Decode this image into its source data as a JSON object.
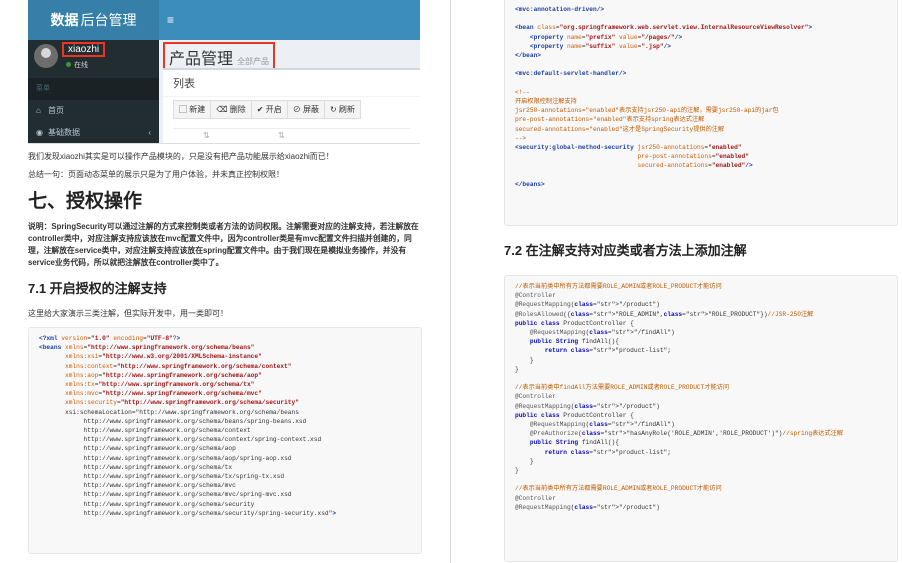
{
  "left_page": {
    "screenshot": {
      "logo_bold": "数据",
      "logo_rest": "后台管理",
      "menu_toggle": "≡",
      "username": "xiaozhi",
      "online": "在线",
      "menu_header": "菜单",
      "menu_items": [
        {
          "icon": "home-icon",
          "label": "首页"
        },
        {
          "icon": "folder-icon",
          "label": "基础数据",
          "arrow": "‹"
        }
      ],
      "page_title": "产品管理",
      "page_subtitle": "全部产品",
      "box_title": "列表",
      "buttons": [
        "新建",
        "删除",
        "开启",
        "屏蔽",
        "刷新"
      ],
      "table_header": [
        "⇅",
        "⇅"
      ]
    },
    "para1": "我们发现xiaozhi其实是可以操作产品模块的，只是没有把产品功能展示给xiaozhi而已！",
    "para2": "总结一句：页面动态菜单的展示只是为了用户体验，并未真正控制权限！",
    "heading": "七、授权操作",
    "note": "说明：SpringSecurity可以通过注解的方式来控制类或者方法的访问权限。注解需要对应的注解支持，若注解放在controller类中，对应注解支持应该放在mvc配置文件中，因为controller类是有mvc配置文件扫描并创建的，同理，注解放在service类中，对应注解支持应该放在spring配置文件中。由于我们现在是模拟业务操作，并没有service业务代码，所以就把注解放在controller类中了。",
    "sub_heading": "7.1 开启授权的注解支持",
    "para3": "这里给大家演示三类注解，但实际开发中，用一类即可！",
    "code_lines": [
      "<?xml version=\"1.0\" encoding=\"UTF-8\"?>",
      "<beans xmlns=\"http://www.springframework.org/schema/beans\"",
      "       xmlns:xsi=\"http://www.w3.org/2001/XMLSchema-instance\"",
      "       xmlns:context=\"http://www.springframework.org/schema/context\"",
      "       xmlns:aop=\"http://www.springframework.org/schema/aop\"",
      "       xmlns:tx=\"http://www.springframework.org/schema/tx\"",
      "       xmlns:mvc=\"http://www.springframework.org/schema/mvc\"",
      "       xmlns:security=\"http://www.springframework.org/schema/security\"",
      "       xsi:schemaLocation=\"http://www.springframework.org/schema/beans",
      "            http://www.springframework.org/schema/beans/spring-beans.xsd",
      "            http://www.springframework.org/schema/context",
      "            http://www.springframework.org/schema/context/spring-context.xsd",
      "            http://www.springframework.org/schema/aop",
      "            http://www.springframework.org/schema/aop/spring-aop.xsd",
      "            http://www.springframework.org/schema/tx",
      "            http://www.springframework.org/schema/tx/spring-tx.xsd",
      "            http://www.springframework.org/schema/mvc",
      "            http://www.springframework.org/schema/mvc/spring-mvc.xsd",
      "            http://www.springframework.org/schema/security",
      "            http://www.springframework.org/schema/security/spring-security.xsd\">"
    ]
  },
  "right_page": {
    "code1_lines": [
      "<mvc:annotation-driven/>",
      "",
      "<bean class=\"org.springframework.web.servlet.view.InternalResourceViewResolver\">",
      "    <property name=\"prefix\" value=\"/pages/\"/>",
      "    <property name=\"suffix\" value=\".jsp\"/>",
      "</bean>",
      "",
      "<mvc:default-servlet-handler/>",
      "",
      "<!--",
      "开启权限控制注解支持",
      "jsr250-annotations=\"enabled\"表示支持jsr250-api的注解，需要jsr250-api的jar包",
      "pre-post-annotations=\"enabled\"表示支持spring表达式注解",
      "secured-annotations=\"enabled\"这才是SpringSecurity提供的注解",
      "-->",
      "<security:global-method-security jsr250-annotations=\"enabled\"",
      "                                 pre-post-annotations=\"enabled\"",
      "                                 secured-annotations=\"enabled\"/>",
      "",
      "</beans>"
    ],
    "heading": "7.2 在注解支持对应类或者方法上添加注解",
    "code2_lines": [
      "//表示当前类中所有方法都需要ROLE_ADMIN或者ROLE_PRODUCT才能访问",
      "@Controller",
      "@RequestMapping(\"/product\")",
      "@RolesAllowed({\"ROLE_ADMIN\",\"ROLE_PRODUCT\"})//JSR-250注解",
      "public class ProductController {",
      "    @RequestMapping(\"/findAll\")",
      "    public String findAll(){",
      "        return \"product-list\";",
      "    }",
      "}",
      "",
      "//表示当前类中findAll方法需要ROLE_ADMIN或者ROLE_PRODUCT才能访问",
      "@Controller",
      "@RequestMapping(\"/product\")",
      "public class ProductController {",
      "    @RequestMapping(\"/findAll\")",
      "    @PreAuthorize(\"hasAnyRole('ROLE_ADMIN','ROLE_PRODUCT')\")//spring表达式注解",
      "    public String findAll(){",
      "        return \"product-list\";",
      "    }",
      "}",
      "",
      "//表示当前类中所有方法都需要ROLE_ADMIN或者ROLE_PRODUCT才能访问",
      "@Controller",
      "@RequestMapping(\"/product\")"
    ]
  }
}
